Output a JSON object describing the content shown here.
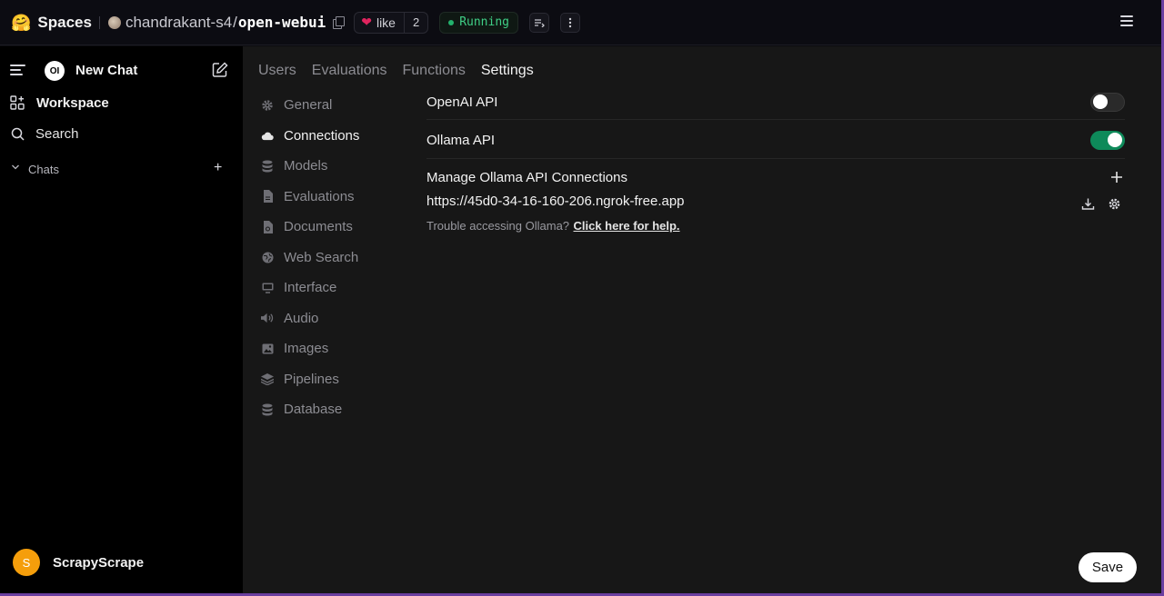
{
  "topbar": {
    "brand": "Spaces",
    "owner": "chandrakant-s4",
    "separator": "/",
    "repo": "open-webui",
    "like_label": "like",
    "like_count": "2",
    "status": "Running",
    "status_color": "#3fcf86"
  },
  "sidebar": {
    "new_chat": "New Chat",
    "logo_text": "OI",
    "workspace": "Workspace",
    "search": "Search",
    "chats": "Chats",
    "user_initial": "S",
    "user_name": "ScrapyScrape"
  },
  "admin_tabs": [
    {
      "label": "Users"
    },
    {
      "label": "Evaluations"
    },
    {
      "label": "Functions"
    },
    {
      "label": "Settings",
      "active": true
    }
  ],
  "settings_nav": [
    {
      "label": "General",
      "icon": "gear-icon"
    },
    {
      "label": "Connections",
      "icon": "cloud-icon",
      "active": true
    },
    {
      "label": "Models",
      "icon": "database-icon"
    },
    {
      "label": "Evaluations",
      "icon": "document-icon"
    },
    {
      "label": "Documents",
      "icon": "file-icon"
    },
    {
      "label": "Web Search",
      "icon": "globe-icon"
    },
    {
      "label": "Interface",
      "icon": "monitor-icon"
    },
    {
      "label": "Audio",
      "icon": "speaker-icon"
    },
    {
      "label": "Images",
      "icon": "image-icon"
    },
    {
      "label": "Pipelines",
      "icon": "layers-icon"
    },
    {
      "label": "Database",
      "icon": "database-icon"
    }
  ],
  "connections": {
    "openai_label": "OpenAI API",
    "openai_enabled": false,
    "ollama_label": "Ollama API",
    "ollama_enabled": true,
    "manage_label": "Manage Ollama API Connections",
    "url": "https://45d0-34-16-160-206.ngrok-free.app",
    "help_text": "Trouble accessing Ollama?",
    "help_link": "Click here for help."
  },
  "save_label": "Save",
  "colors": {
    "accent_green": "#0e8a5a",
    "avatar": "#f59e0b",
    "heart": "#e0245e"
  }
}
